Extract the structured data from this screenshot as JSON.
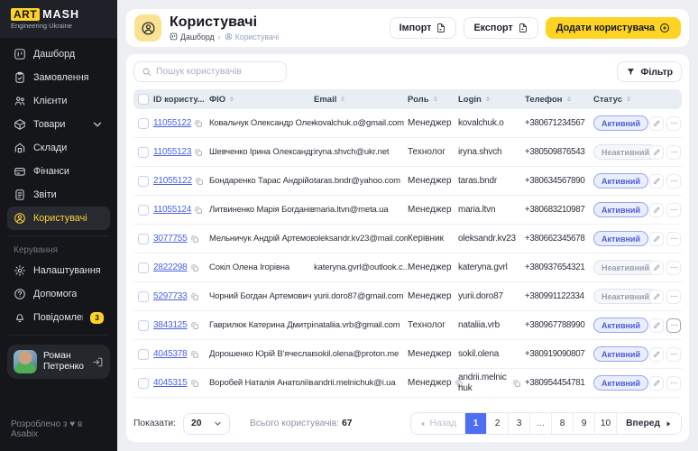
{
  "colors": {
    "accent_yellow": "#FFD324",
    "primary_blue": "#4D6EF2",
    "link_blue": "#4B61E4",
    "badge_active_text": "#4E5FD9",
    "sidebar_bg": "#14161A"
  },
  "sidebar": {
    "logo": {
      "art": "ART",
      "mash": "MASH",
      "subtitle": "Engineering Ukraine"
    },
    "items": [
      {
        "id": "dashboard",
        "icon": "dashboard",
        "label": "Дашборд"
      },
      {
        "id": "orders",
        "icon": "orders",
        "label": "Замовлення"
      },
      {
        "id": "clients",
        "icon": "clients",
        "label": "Клієнти"
      },
      {
        "id": "products",
        "icon": "products",
        "label": "Товари",
        "expandable": true
      },
      {
        "id": "warehouses",
        "icon": "warehouse",
        "label": "Склади"
      },
      {
        "id": "finances",
        "icon": "finances",
        "label": "Фінанси"
      },
      {
        "id": "reports",
        "icon": "reports",
        "label": "Звіти"
      },
      {
        "id": "users",
        "icon": "user-circle",
        "label": "Користувачі",
        "active": true
      }
    ],
    "management": {
      "label": "Керування",
      "items": [
        {
          "id": "settings",
          "icon": "settings",
          "label": "Налаштування"
        },
        {
          "id": "help",
          "icon": "help",
          "label": "Допомога"
        },
        {
          "id": "notifications",
          "icon": "bell",
          "label": "Повідомлення",
          "badge": "3"
        }
      ]
    },
    "profile": {
      "name": "Роман Петренко"
    },
    "footer": "Розроблено з ♥ в Asabix"
  },
  "header": {
    "title": "Користувачі",
    "breadcrumb": [
      {
        "icon": "dashboard",
        "label": "Дашборд"
      },
      {
        "icon": "user-circle",
        "label": "Користувачі"
      }
    ],
    "import_label": "Імпорт",
    "export_label": "Експорт",
    "add_label": "Додати користувача"
  },
  "toolbar": {
    "search_placeholder": "Пошук користувачів",
    "filter_label": "Фільтр"
  },
  "table": {
    "columns": [
      "ID користу...",
      "ФІО",
      "Email",
      "Роль",
      "Login",
      "Телефон",
      "Статус"
    ],
    "rows": [
      {
        "id": "11055122",
        "fio": "Ковальчук Олександр Олекс...",
        "email": "kovalchuk.o@gmail.com",
        "role": "Менеджер",
        "login": "kovalchuk.o",
        "phone": "+380671234567",
        "status": "Активний",
        "active": true
      },
      {
        "id": "11055123",
        "fio": "Шевченко Ірина Олександрі...",
        "email": "iryna.shvch@ukr.net",
        "role": "Технолог",
        "login": "iryna.shvch",
        "phone": "+380509876543",
        "status": "Неактивний",
        "active": false
      },
      {
        "id": "21055122",
        "fio": "Бондаренко Тарас Андрійов...",
        "email": "taras.bndr@yahoo.com",
        "role": "Менеджер",
        "login": "taras.bndr",
        "phone": "+380634567890",
        "status": "Активний",
        "active": true
      },
      {
        "id": "11055124",
        "fio": "Литвиненко Марія Богданів...",
        "email": "maria.ltvn@meta.ua",
        "role": "Менеджер",
        "login": "maria.ltvn",
        "phone": "+380683210987",
        "status": "Активний",
        "active": true
      },
      {
        "id": "3077755",
        "fio": "Мельничук Андрій Артемов...",
        "email": "oleksandr.kv23@mail.com",
        "role": "Керівник",
        "login": "oleksandr.kv23",
        "phone": "+380662345678",
        "status": "Активний",
        "active": true
      },
      {
        "id": "2822298",
        "fio": "Сокіл Олена Ігорівна",
        "email": "kateryna.gvrl@outlook.c...",
        "role": "Менеджер",
        "login": "kateryna.gvrl",
        "phone": "+380937654321",
        "status": "Неактивний",
        "active": false
      },
      {
        "id": "5297733",
        "fio": "Чорний Богдан Артемович",
        "email": "yurii.doro87@gmail.com",
        "role": "Менеджер",
        "login": "yurii.doro87",
        "phone": "+380991122334",
        "status": "Неактивний",
        "active": false
      },
      {
        "id": "3843125",
        "fio": "Гаврилюк Катерина Дмитріє...",
        "email": "nataliia.vrb@gmail.com",
        "role": "Технолог",
        "login": "nataliia.vrb",
        "phone": "+380967788990",
        "status": "Активний",
        "active": true,
        "more_highlight": true
      },
      {
        "id": "4045378",
        "fio": "Дорошенко Юрій В'ячеслав...",
        "email": "sokil.olena@proton.me",
        "role": "Менеджер",
        "login": "sokil.olena",
        "phone": "+380919090807",
        "status": "Активний",
        "active": true
      },
      {
        "id": "4045315",
        "fio": "Воробей Наталія Анатоліївна",
        "email": "andrii.melnichuk@i.ua",
        "role": "Менеджер",
        "login": "andrii.melnichuk",
        "phone": "+380954454781",
        "status": "Активний",
        "active": true,
        "role_copy": true,
        "login_copy": true
      }
    ]
  },
  "footer_bar": {
    "show_label": "Показати:",
    "page_size": "20",
    "total_label": "Всього користувачів:",
    "total_value": "67",
    "prev_label": "Назад",
    "next_label": "Вперед",
    "pages": [
      "1",
      "2",
      "3",
      "...",
      "8",
      "9",
      "10"
    ],
    "active_page": "1"
  }
}
